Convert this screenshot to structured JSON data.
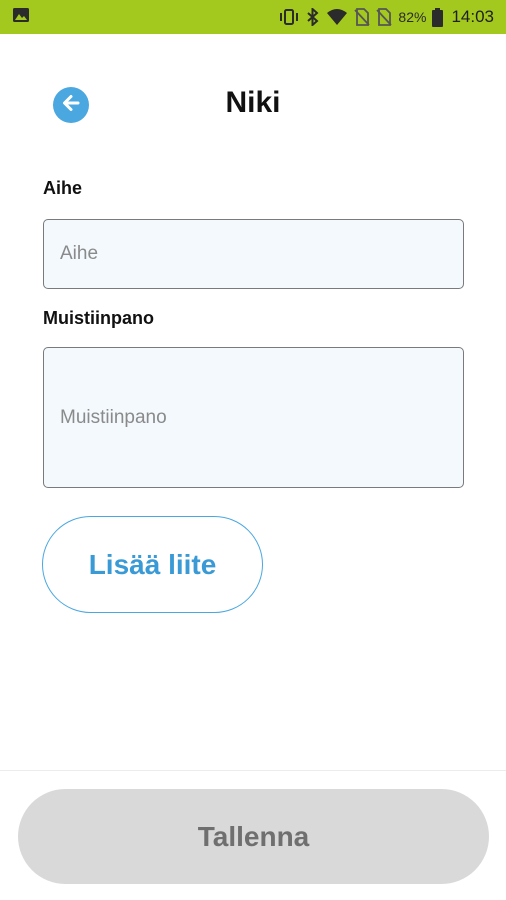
{
  "status_bar": {
    "battery_percent": "82%",
    "time": "14:03",
    "icons": [
      "image-icon",
      "vibrate-icon",
      "bluetooth-icon",
      "wifi-icon",
      "no-sim-icon",
      "no-sim-icon",
      "battery-icon"
    ],
    "background_color": "#a4c91e"
  },
  "header": {
    "title": "Niki",
    "back_icon": "arrow-left-circle-icon",
    "accent_color": "#4aa7e0"
  },
  "form": {
    "subject": {
      "label": "Aihe",
      "placeholder": "Aihe",
      "value": ""
    },
    "note": {
      "label": "Muistiinpano",
      "placeholder": "Muistiinpano",
      "value": ""
    },
    "attach_label": "Lisää liite"
  },
  "footer": {
    "save_label": "Tallenna",
    "save_enabled": false
  }
}
